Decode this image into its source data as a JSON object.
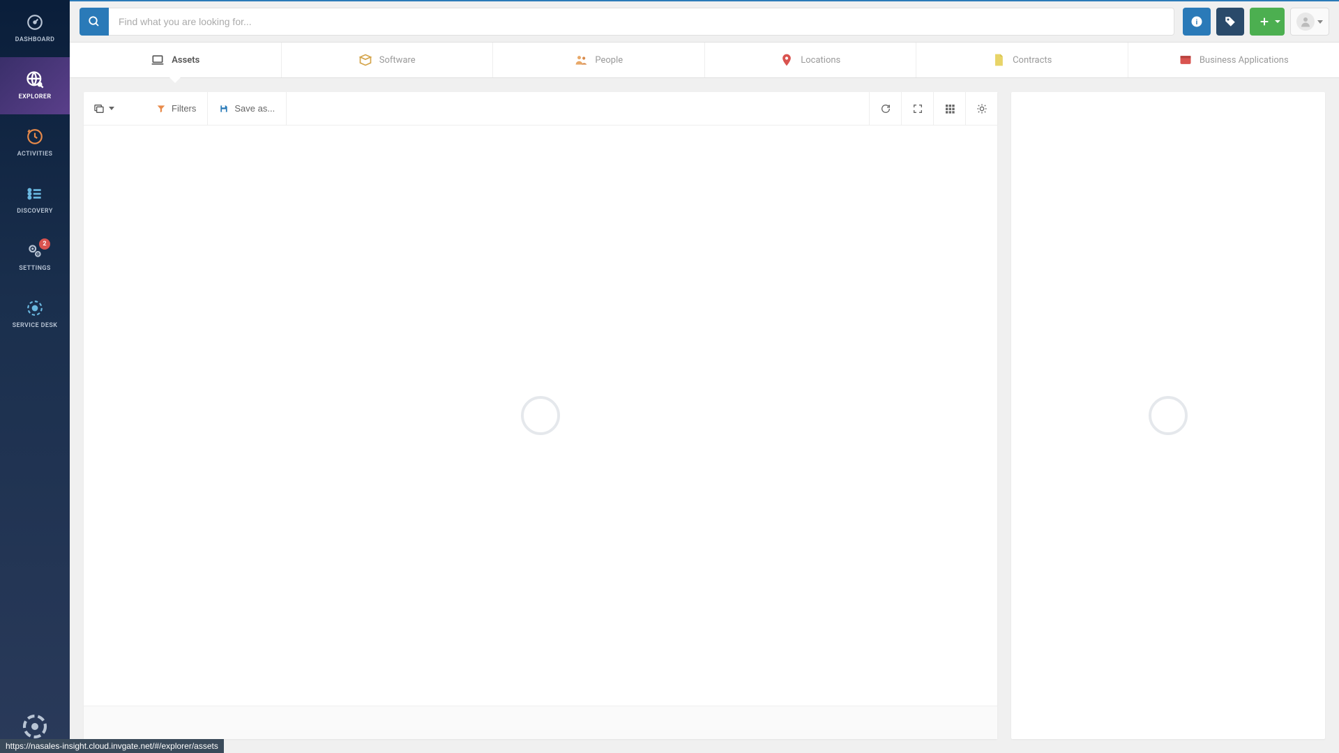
{
  "sidebar": {
    "items": [
      {
        "label": "DASHBOARD"
      },
      {
        "label": "EXPLORER"
      },
      {
        "label": "ACTIVITIES"
      },
      {
        "label": "DISCOVERY"
      },
      {
        "label": "SETTINGS",
        "badge": "2"
      },
      {
        "label": "SERVICE DESK"
      }
    ]
  },
  "header": {
    "search_placeholder": "Find what you are looking for..."
  },
  "tabs": [
    {
      "label": "Assets"
    },
    {
      "label": "Software"
    },
    {
      "label": "People"
    },
    {
      "label": "Locations"
    },
    {
      "label": "Contracts"
    },
    {
      "label": "Business Applications"
    }
  ],
  "toolbar": {
    "filters_label": "Filters",
    "save_label": "Save as..."
  },
  "status_url": "https://nasales-insight.cloud.invgate.net/#/explorer/assets"
}
